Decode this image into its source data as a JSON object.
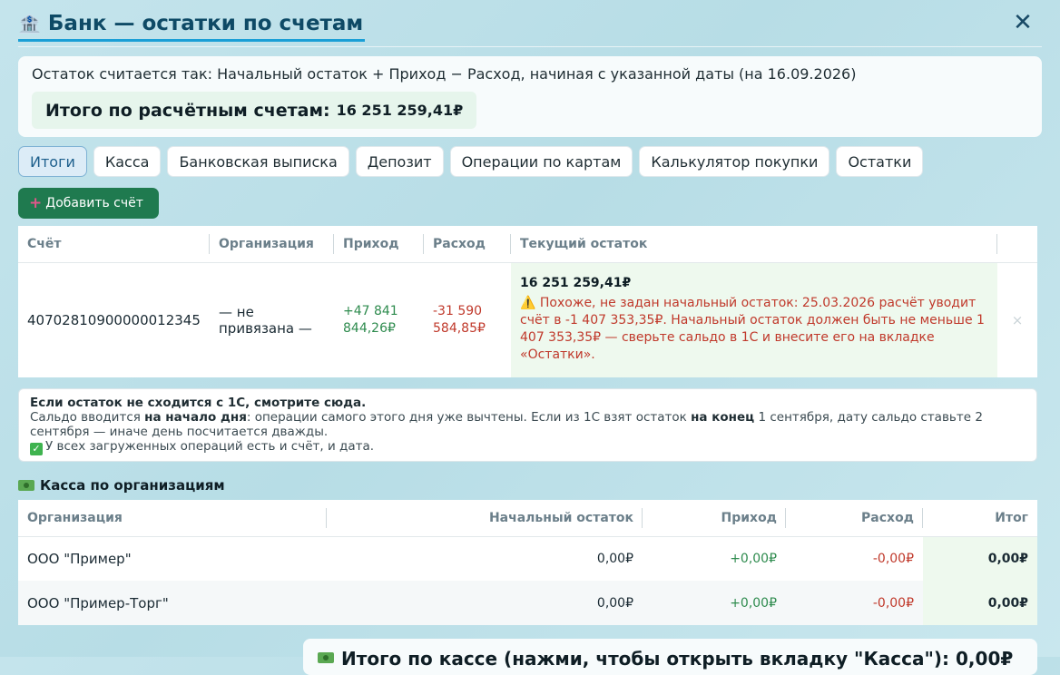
{
  "header": {
    "title": "Банк — остатки по счетам",
    "close_label": "✕"
  },
  "summary": {
    "formula": "Остаток считается так: Начальный остаток + Приход − Расход, начиная с указанной даты (на 16.09.2026)",
    "total_label": "Итого по расчётным счетам:",
    "total_value": "16 251 259,41₽"
  },
  "tabs": [
    "Итоги",
    "Касса",
    "Банковская выписка",
    "Депозит",
    "Операции по картам",
    "Калькулятор покупки",
    "Остатки"
  ],
  "add_account_label": "Добавить счёт",
  "accounts": {
    "headers": [
      "Счёт",
      "Организация",
      "Приход",
      "Расход",
      "Текущий остаток"
    ],
    "rows": [
      {
        "account": "40702810900000012345",
        "org": "— не привязана —",
        "income_1": "+47 841",
        "income_2": "844,26₽",
        "expense_1": "-31 590",
        "expense_2": "584,85₽",
        "balance": "16 251 259,41₽",
        "warning": "⚠️ Похоже, не задан начальный остаток: 25.03.2026 расчёт уводит счёт в -1 407 353,35₽. Начальный остаток должен быть не меньше 1 407 353,35₽ — сверьте сальдо в 1С и внесите его на вкладке «Остатки».",
        "delete": "×"
      }
    ]
  },
  "note": {
    "title": "Если остаток не сходится с 1С, смотрите сюда.",
    "p1": "Сальдо вводится ",
    "b1": "на начало дня",
    "p2": ": операции самого этого дня уже вычтены. Если из 1С взят остаток ",
    "b2": "на конец",
    "p3": " 1 сентября, дату сальдо ставьте 2 сентября — иначе день посчитается дважды.",
    "check": "У всех загруженных операций есть и счёт, и дата."
  },
  "cash": {
    "title": "Касса по организациям",
    "headers": [
      "Организация",
      "Начальный остаток",
      "Приход",
      "Расход",
      "Итог"
    ],
    "rows": [
      {
        "org": "ООО \"Пример\"",
        "start": "0,00₽",
        "income": "+0,00₽",
        "expense": "-0,00₽",
        "total": "0,00₽"
      },
      {
        "org": "ООО \"Пример-Торг\"",
        "start": "0,00₽",
        "income": "+0,00₽",
        "expense": "-0,00₽",
        "total": "0,00₽"
      }
    ]
  },
  "footer_total": "Итого по кассе (нажми, чтобы открыть вкладку \"Касса\"): 0,00₽"
}
